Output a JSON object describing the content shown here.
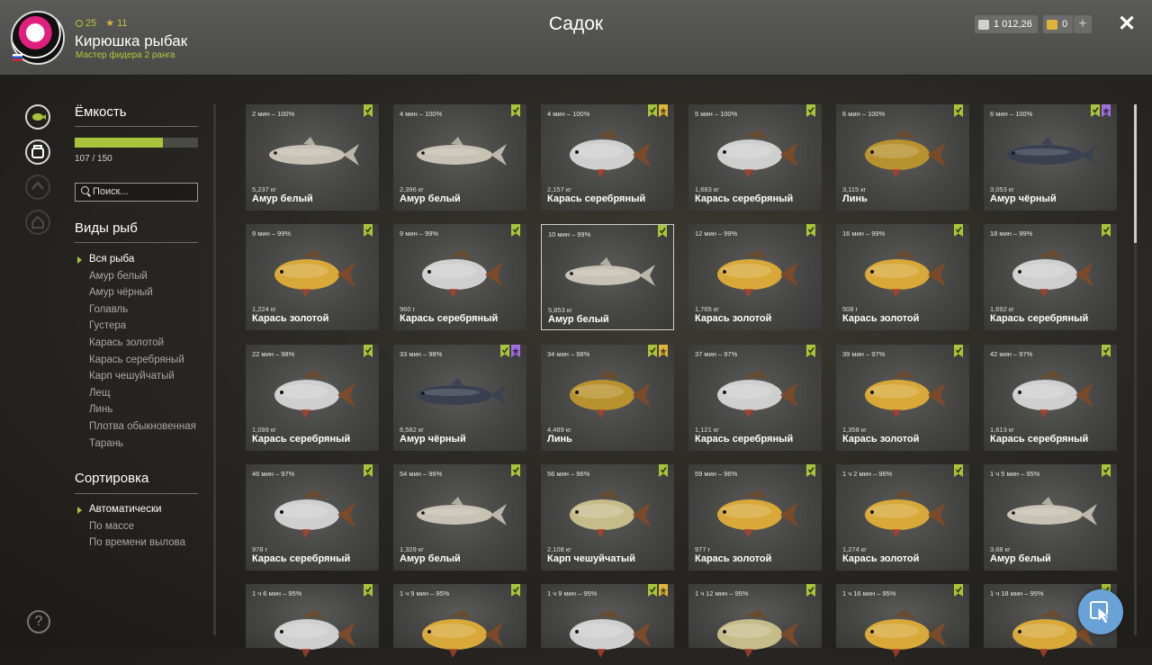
{
  "header": {
    "level": "25",
    "stars": "11",
    "username": "Кирюшка рыбак",
    "rank": "Мастер фидера 2 ранга",
    "title": "Садок",
    "silver": "1 012,26",
    "gold": "0",
    "add_label": "+",
    "close_label": "✕"
  },
  "sidebar": {
    "capacity_title": "Ёмкость",
    "capacity_value": 107,
    "capacity_max": 150,
    "capacity_text": "107 / 150",
    "search_placeholder": "Поиск...",
    "species_title": "Виды рыб",
    "species": [
      "Вся рыба",
      "Амур белый",
      "Амур чёрный",
      "Голавль",
      "Густера",
      "Карась золотой",
      "Карась серебряный",
      "Карп чешуйчатый",
      "Лещ",
      "Линь",
      "Плотва обыкновенная",
      "Тарань"
    ],
    "species_selected": 0,
    "sort_title": "Сортировка",
    "sort_options": [
      "Автоматически",
      "По массе",
      "По времени вылова"
    ],
    "sort_selected": 0,
    "help_label": "?"
  },
  "colors": {
    "accent": "#a9c43a",
    "badge_green": "#a9c43a",
    "badge_gold": "#e0b43a",
    "badge_purple": "#a070e0"
  },
  "fish_colors": {
    "Амур белый": "#c8c2b4",
    "Амур чёрный": "#3a4050",
    "Карась серебряный": "#cfcfcf",
    "Карась золотой": "#d8a838",
    "Линь": "#b8922e",
    "Карп чешуйчатый": "#c6bc8a"
  },
  "fish": [
    {
      "time": "2 мин – 100%",
      "weight": "5,237 кг",
      "name": "Амур белый",
      "badges": [
        "green"
      ]
    },
    {
      "time": "4 мин – 100%",
      "weight": "2,396 кг",
      "name": "Амур белый",
      "badges": [
        "green"
      ]
    },
    {
      "time": "4 мин – 100%",
      "weight": "2,157 кг",
      "name": "Карась серебряный",
      "badges": [
        "green",
        "gold"
      ]
    },
    {
      "time": "5 мин – 100%",
      "weight": "1,683 кг",
      "name": "Карась серебряный",
      "badges": [
        "green"
      ]
    },
    {
      "time": "6 мин – 100%",
      "weight": "3,115 кг",
      "name": "Линь",
      "badges": [
        "green"
      ]
    },
    {
      "time": "6 мин – 100%",
      "weight": "3,053 кг",
      "name": "Амур чёрный",
      "badges": [
        "green",
        "purple"
      ]
    },
    {
      "time": "9 мин – 99%",
      "weight": "1,224 кг",
      "name": "Карась золотой",
      "badges": [
        "green"
      ]
    },
    {
      "time": "9 мин – 99%",
      "weight": "960 г",
      "name": "Карась серебряный",
      "badges": [
        "green"
      ]
    },
    {
      "time": "10 мин – 99%",
      "weight": "5,853 кг",
      "name": "Амур белый",
      "badges": [
        "green"
      ],
      "selected": true
    },
    {
      "time": "12 мин – 99%",
      "weight": "1,765 кг",
      "name": "Карась золотой",
      "badges": [
        "green"
      ]
    },
    {
      "time": "16 мин – 99%",
      "weight": "508 г",
      "name": "Карась золотой",
      "badges": [
        "green"
      ]
    },
    {
      "time": "18 мин – 99%",
      "weight": "1,692 кг",
      "name": "Карась серебряный",
      "badges": [
        "green"
      ]
    },
    {
      "time": "22 мин – 98%",
      "weight": "1,099 кг",
      "name": "Карась серебряный",
      "badges": [
        "green"
      ]
    },
    {
      "time": "33 мин – 98%",
      "weight": "6,582 кг",
      "name": "Амур чёрный",
      "badges": [
        "green",
        "purple"
      ]
    },
    {
      "time": "34 мин – 98%",
      "weight": "4,489 кг",
      "name": "Линь",
      "badges": [
        "green",
        "gold"
      ]
    },
    {
      "time": "37 мин – 97%",
      "weight": "1,121 кг",
      "name": "Карась серебряный",
      "badges": [
        "green"
      ]
    },
    {
      "time": "39 мин – 97%",
      "weight": "1,358 кг",
      "name": "Карась золотой",
      "badges": [
        "green"
      ]
    },
    {
      "time": "42 мин – 97%",
      "weight": "1,613 кг",
      "name": "Карась серебряный",
      "badges": [
        "green"
      ]
    },
    {
      "time": "46 мин – 97%",
      "weight": "978 г",
      "name": "Карась серебряный",
      "badges": [
        "green"
      ]
    },
    {
      "time": "54 мин – 96%",
      "weight": "1,329 кг",
      "name": "Амур белый",
      "badges": [
        "green"
      ]
    },
    {
      "time": "56 мин – 96%",
      "weight": "2,108 кг",
      "name": "Карп чешуйчатый",
      "badges": [
        "green"
      ]
    },
    {
      "time": "59 мин – 96%",
      "weight": "977 г",
      "name": "Карась золотой",
      "badges": [
        "green"
      ]
    },
    {
      "time": "1 ч 2 мин – 96%",
      "weight": "1,274 кг",
      "name": "Карась золотой",
      "badges": [
        "green"
      ]
    },
    {
      "time": "1 ч 5 мин – 95%",
      "weight": "3,68 кг",
      "name": "Амур белый",
      "badges": [
        "green"
      ]
    },
    {
      "time": "1 ч 6 мин – 95%",
      "weight": "",
      "name": "",
      "species": "Карась серебряный",
      "badges": [
        "green"
      ]
    },
    {
      "time": "1 ч 9 мин – 95%",
      "weight": "",
      "name": "",
      "species": "Карась золотой",
      "badges": [
        "green"
      ]
    },
    {
      "time": "1 ч 9 мин – 95%",
      "weight": "",
      "name": "",
      "species": "Карась серебряный",
      "badges": [
        "green",
        "gold"
      ]
    },
    {
      "time": "1 ч 12 мин – 95%",
      "weight": "",
      "name": "",
      "species": "Карп чешуйчатый",
      "badges": [
        "green"
      ]
    },
    {
      "time": "1 ч 16 мин – 95%",
      "weight": "",
      "name": "",
      "species": "Карась золотой",
      "badges": [
        "green"
      ]
    },
    {
      "time": "1 ч 18 мин – 95%",
      "weight": "",
      "name": "",
      "species": "Карась золотой",
      "badges": [
        "green"
      ]
    }
  ]
}
